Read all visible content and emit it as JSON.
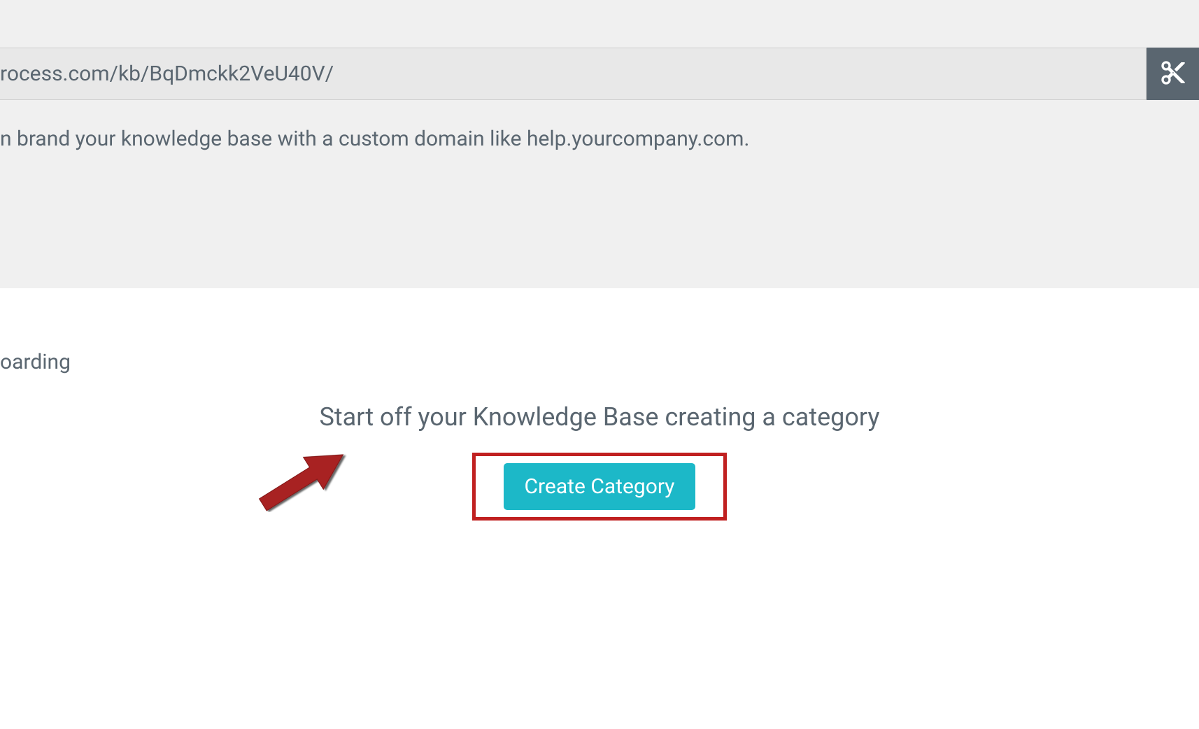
{
  "url_bar": {
    "value": "rocess.com/kb/BqDmckk2VeU40V/"
  },
  "helper_text": "n brand your knowledge base with a custom domain like help.yourcompany.com.",
  "breadcrumb": "oarding",
  "empty_state": {
    "heading": "Start off your Knowledge Base creating a category",
    "button_label": "Create Category"
  }
}
